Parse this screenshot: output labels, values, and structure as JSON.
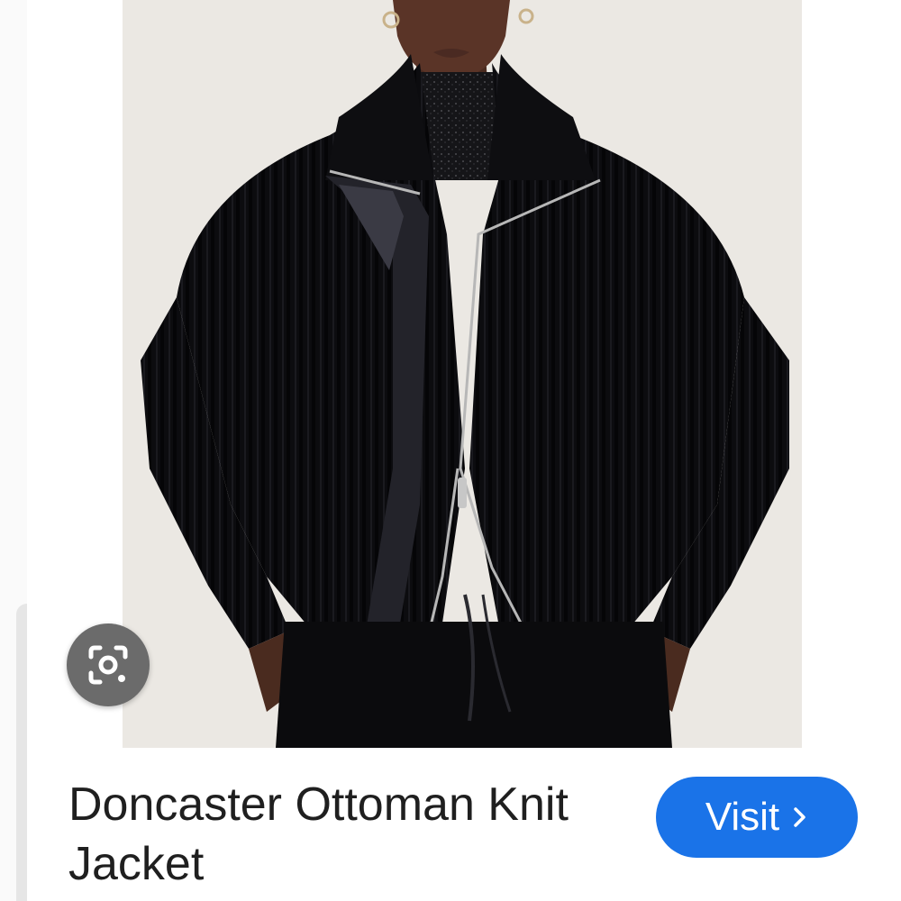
{
  "result": {
    "title": "Doncaster Ottoman Knit Jacket",
    "visit_label": "Visit",
    "visit_icon": "chevron-right-icon",
    "lens_icon": "google-lens-icon",
    "image_alt": "Woman wearing a black ribbed knit zip jacket"
  },
  "colors": {
    "accent": "#1a73e8",
    "image_background": "#ebe8e3",
    "lens_button": "#6b6b6b",
    "title_text": "#1f1f1f"
  }
}
